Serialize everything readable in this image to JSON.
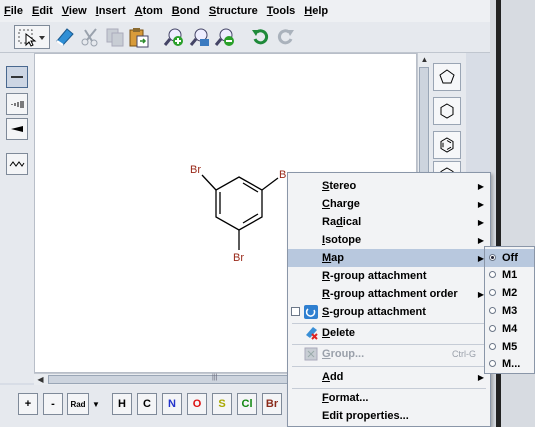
{
  "menubar": {
    "items": [
      {
        "mnemonic": "F",
        "rest": "ile"
      },
      {
        "mnemonic": "E",
        "rest": "dit"
      },
      {
        "mnemonic": "V",
        "rest": "iew"
      },
      {
        "mnemonic": "I",
        "rest": "nsert"
      },
      {
        "mnemonic": "A",
        "rest": "tom"
      },
      {
        "mnemonic": "B",
        "rest": "ond"
      },
      {
        "mnemonic": "S",
        "rest": "tructure"
      },
      {
        "mnemonic": "T",
        "rest": "ools"
      },
      {
        "mnemonic": "H",
        "rest": "elp"
      }
    ]
  },
  "molecule": {
    "atoms": {
      "br1": "Br",
      "br2": "Br",
      "br3": "Br"
    }
  },
  "atombar": {
    "plus": "+",
    "minus": "-",
    "rad": "Rad",
    "elements": [
      {
        "symbol": "H",
        "color": "#000000"
      },
      {
        "symbol": "C",
        "color": "#000000"
      },
      {
        "symbol": "N",
        "color": "#2233cc"
      },
      {
        "symbol": "O",
        "color": "#dd1111"
      },
      {
        "symbol": "S",
        "color": "#a8a800"
      },
      {
        "symbol": "Cl",
        "color": "#118811"
      },
      {
        "symbol": "Br",
        "color": "#8a2a1a"
      }
    ]
  },
  "context_menu": {
    "stereo": {
      "mn": "S",
      "rest": "tereo"
    },
    "charge": {
      "mn": "C",
      "rest": "harge"
    },
    "radical": {
      "pre": "Ra",
      "mn": "d",
      "rest": "ical"
    },
    "isotope": {
      "mn": "I",
      "rest": "sotope"
    },
    "map": {
      "mn": "M",
      "rest": "ap"
    },
    "rgroup_attachment": {
      "mn": "R",
      "rest": "-group attachment"
    },
    "rgroup_attachment_order": {
      "mn": "R",
      "rest": "-group attachment order"
    },
    "sgroup_attachment": {
      "mn": "S",
      "rest": "-group attachment"
    },
    "delete": {
      "mn": "D",
      "rest": "elete"
    },
    "group": {
      "mn": "G",
      "rest": "roup...",
      "shortcut": "Ctrl-G"
    },
    "add": {
      "mn": "A",
      "rest": "dd"
    },
    "format": {
      "mn": "F",
      "rest": "ormat..."
    },
    "edit_properties": "Edit properties..."
  },
  "map_submenu": {
    "items": [
      "Off",
      "M1",
      "M2",
      "M3",
      "M4",
      "M5",
      "M..."
    ],
    "selected": "Off"
  },
  "colors": {
    "highlight": "#b8c8de",
    "bromine": "#9a2a1a"
  }
}
